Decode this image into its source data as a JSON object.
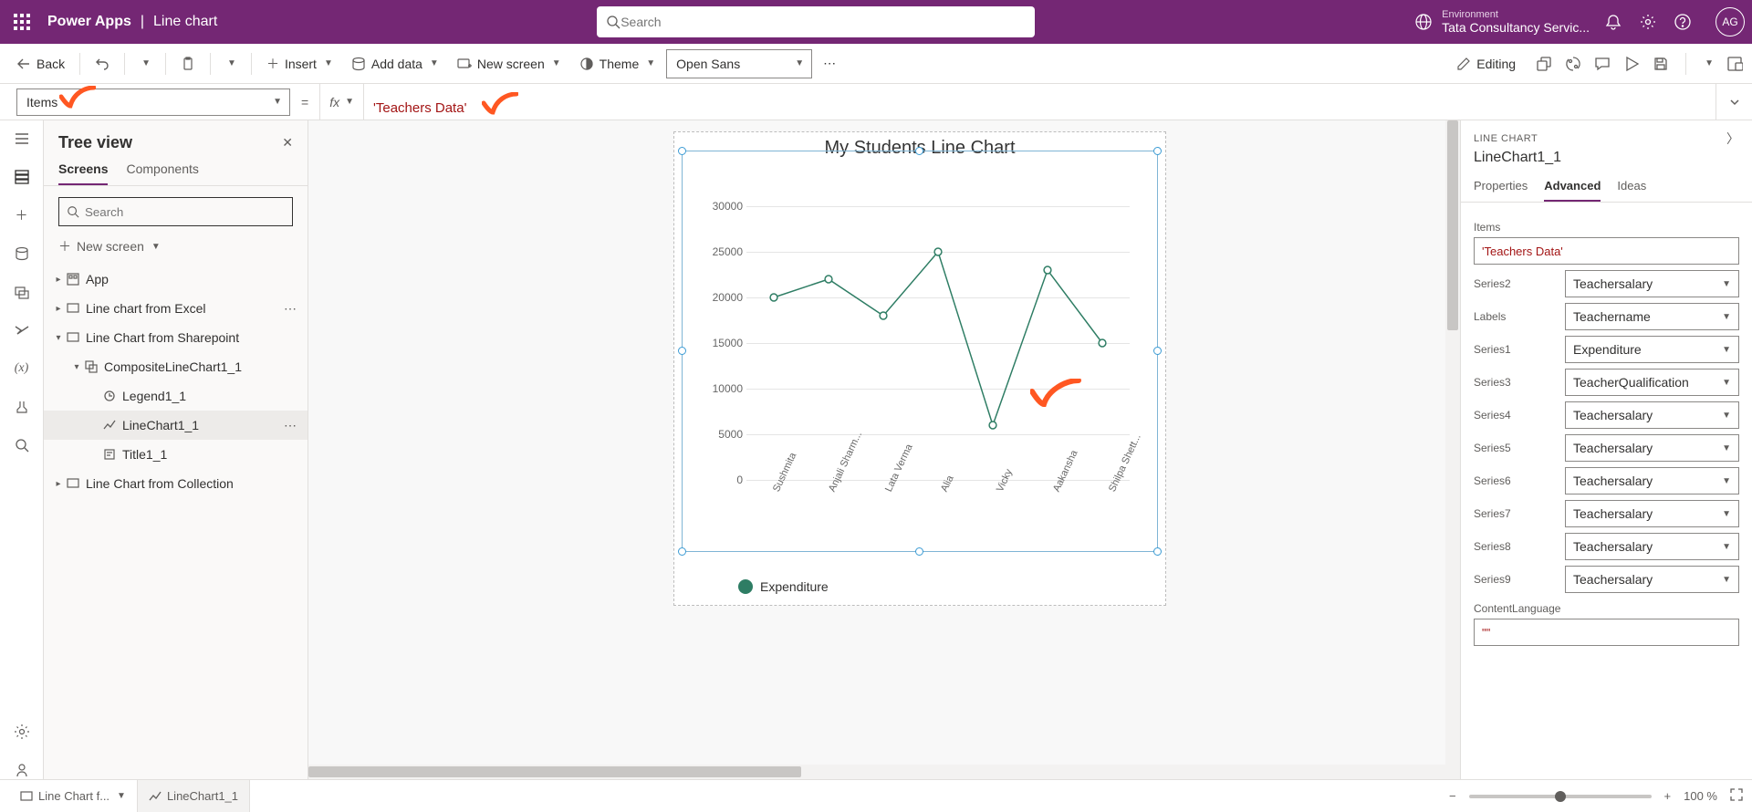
{
  "topbar": {
    "brand": "Power Apps",
    "title": "Line chart",
    "search_placeholder": "Search",
    "env_label": "Environment",
    "env_name": "Tata Consultancy Servic...",
    "avatar": "AG"
  },
  "cmdbar": {
    "back": "Back",
    "insert": "Insert",
    "add_data": "Add data",
    "new_screen": "New screen",
    "theme": "Theme",
    "font": "Open Sans",
    "editing": "Editing"
  },
  "formula": {
    "property": "Items",
    "value": "'Teachers Data'"
  },
  "tree": {
    "title": "Tree view",
    "tab_screens": "Screens",
    "tab_components": "Components",
    "search_placeholder": "Search",
    "new_screen": "New screen",
    "nodes": [
      {
        "label": "App",
        "indent": 0,
        "tw": ">",
        "icon": "app"
      },
      {
        "label": "Line chart from Excel",
        "indent": 0,
        "tw": ">",
        "icon": "screen",
        "more": true
      },
      {
        "label": "Line Chart from Sharepoint",
        "indent": 0,
        "tw": "v",
        "icon": "screen"
      },
      {
        "label": "CompositeLineChart1_1",
        "indent": 1,
        "tw": "v",
        "icon": "group"
      },
      {
        "label": "Legend1_1",
        "indent": 2,
        "tw": "",
        "icon": "legend"
      },
      {
        "label": "LineChart1_1",
        "indent": 2,
        "tw": "",
        "icon": "chart",
        "sel": true,
        "more": true
      },
      {
        "label": "Title1_1",
        "indent": 2,
        "tw": "",
        "icon": "title"
      },
      {
        "label": "Line Chart from Collection",
        "indent": 0,
        "tw": ">",
        "icon": "screen"
      }
    ]
  },
  "chart_data": {
    "type": "line",
    "title": "My Students Line Chart",
    "categories": [
      "Sushmita",
      "Anjali Sharm...",
      "Lata Verma",
      "Alia",
      "Vicky",
      "Aakansha",
      "Shilpa Shett..."
    ],
    "series": [
      {
        "name": "Expenditure",
        "values": [
          20000,
          22000,
          18000,
          25000,
          6000,
          23000,
          15000
        ]
      }
    ],
    "ylim": [
      0,
      30000
    ],
    "yticks": [
      0,
      5000,
      10000,
      15000,
      20000,
      25000,
      30000
    ]
  },
  "rpanel": {
    "type": "LINE CHART",
    "name": "LineChart1_1",
    "tabs": {
      "props": "Properties",
      "adv": "Advanced",
      "ideas": "Ideas"
    },
    "items_label": "Items",
    "items_value": "'Teachers Data'",
    "series": [
      {
        "k": "Series2",
        "v": "Teachersalary"
      },
      {
        "k": "Labels",
        "v": "Teachername"
      },
      {
        "k": "Series1",
        "v": "Expenditure"
      },
      {
        "k": "Series3",
        "v": "TeacherQualification"
      },
      {
        "k": "Series4",
        "v": "Teachersalary"
      },
      {
        "k": "Series5",
        "v": "Teachersalary"
      },
      {
        "k": "Series6",
        "v": "Teachersalary"
      },
      {
        "k": "Series7",
        "v": "Teachersalary"
      },
      {
        "k": "Series8",
        "v": "Teachersalary"
      },
      {
        "k": "Series9",
        "v": "Teachersalary"
      }
    ],
    "contentlang_label": "ContentLanguage",
    "contentlang_value": "\"\""
  },
  "statusbar": {
    "crumb1": "Line Chart f...",
    "crumb2": "LineChart1_1",
    "zoom": "100 %"
  }
}
